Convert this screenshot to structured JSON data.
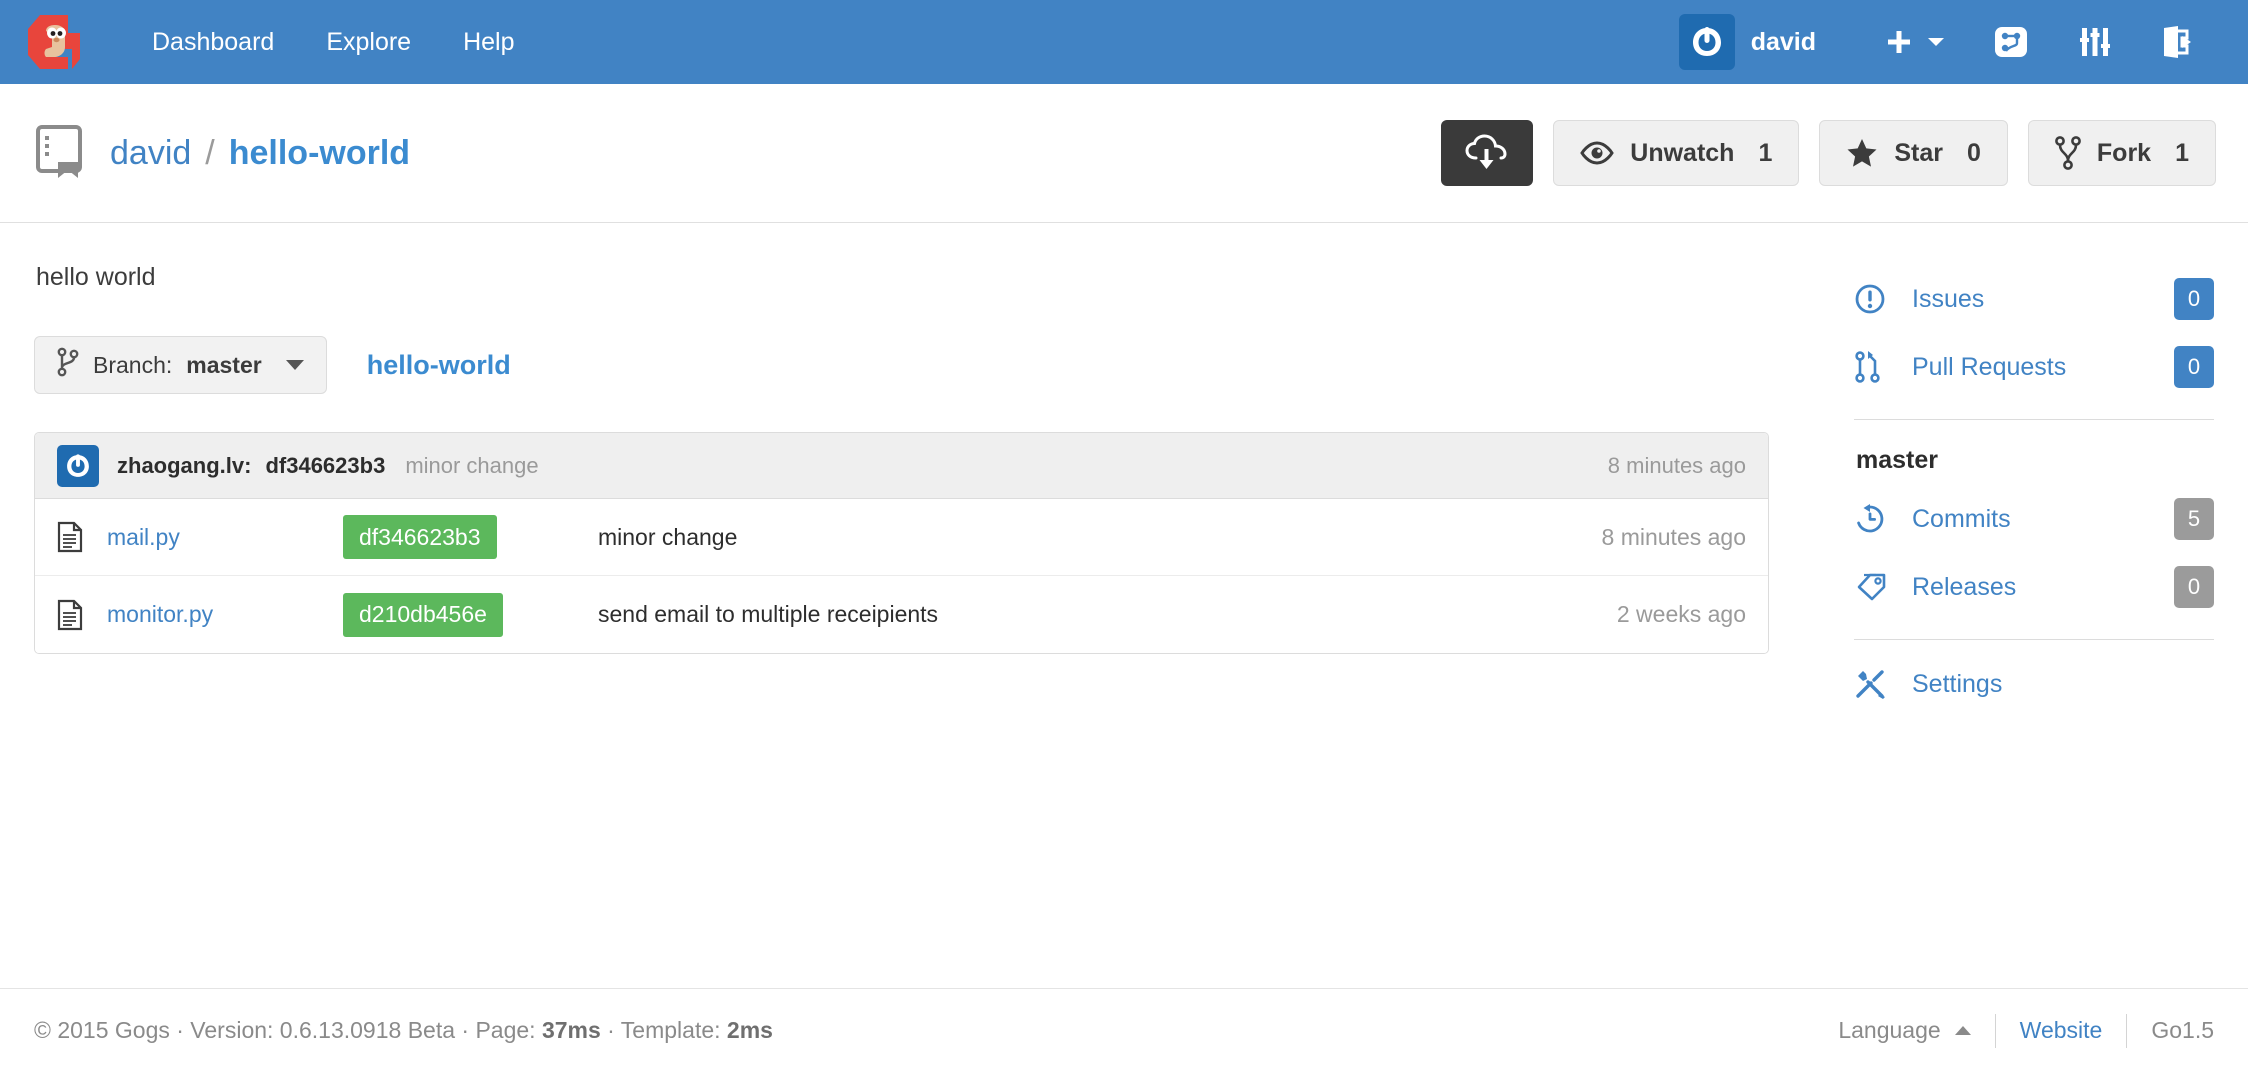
{
  "navbar": {
    "logo_icon": "gogs-gopher-logo",
    "links": [
      {
        "label": "Dashboard",
        "icon": "none"
      },
      {
        "label": "Explore",
        "icon": "none"
      },
      {
        "label": "Help",
        "icon": "none"
      }
    ],
    "user": {
      "name": "david",
      "avatar_icon": "gogs-power-avatar"
    },
    "icons": [
      {
        "name": "plus-icon",
        "label": "+"
      },
      {
        "name": "chevron-down-icon",
        "label": ""
      },
      {
        "name": "repo-forked-icon",
        "label": ""
      },
      {
        "name": "equalizer-icon",
        "label": ""
      },
      {
        "name": "sign-out-icon",
        "label": ""
      }
    ],
    "background_color": "#4183c4"
  },
  "repo_header": {
    "icon": "repo-book-icon",
    "owner": "david",
    "separator": "/",
    "name": "hello-world",
    "actions": {
      "clone_icon": "cloud-download-icon",
      "watch": {
        "label": "Unwatch",
        "count": "1",
        "icon": "eye-icon"
      },
      "star": {
        "label": "Star",
        "count": "0",
        "icon": "star-icon"
      },
      "fork": {
        "label": "Fork",
        "count": "1",
        "icon": "fork-icon"
      }
    }
  },
  "main": {
    "description": "hello world",
    "branch_selector": {
      "icon": "git-branch-icon",
      "prefix": "Branch:",
      "value": "master"
    },
    "breadcrumb": "hello-world",
    "latest_commit": {
      "avatar_icon": "gogs-power-avatar",
      "author": "zhaogang.lv:",
      "sha": "df346623b3",
      "message": "minor change",
      "time": "8 minutes ago"
    },
    "files": [
      {
        "icon": "file-text-icon",
        "name": "mail.py",
        "sha": "df346623b3",
        "message": "minor change",
        "time": "8 minutes ago"
      },
      {
        "icon": "file-text-icon",
        "name": "monitor.py",
        "sha": "d210db456e",
        "message": "send email to multiple receipients",
        "time": "2 weeks ago"
      }
    ]
  },
  "sidebar": {
    "top_items": [
      {
        "icon": "issue-opened-icon",
        "label": "Issues",
        "count": "0",
        "badge_color": "#4183c4"
      },
      {
        "icon": "git-pull-request-icon",
        "label": "Pull Requests",
        "count": "0",
        "badge_color": "#4183c4"
      }
    ],
    "branch_heading": "master",
    "branch_items": [
      {
        "icon": "history-icon",
        "label": "Commits",
        "count": "5",
        "badge_color": "#9b9b9b"
      },
      {
        "icon": "tag-icon",
        "label": "Releases",
        "count": "0",
        "badge_color": "#9b9b9b"
      }
    ],
    "settings": {
      "icon": "tools-icon",
      "label": "Settings"
    }
  },
  "footer": {
    "copyright": "© 2015 Gogs · Version: 0.6.13.0918 Beta · Page: ",
    "page_time": "37ms",
    "template_prefix": " · Template: ",
    "template_time": "2ms",
    "language_label": "Language",
    "website_label": "Website",
    "go_version": "Go1.5"
  },
  "colors": {
    "brand_blue": "#4183c4",
    "link_blue": "#3b8bd0",
    "sha_green": "#5cb85c",
    "dark_button": "#3a3a3a",
    "muted_text": "#9a9a9a"
  }
}
